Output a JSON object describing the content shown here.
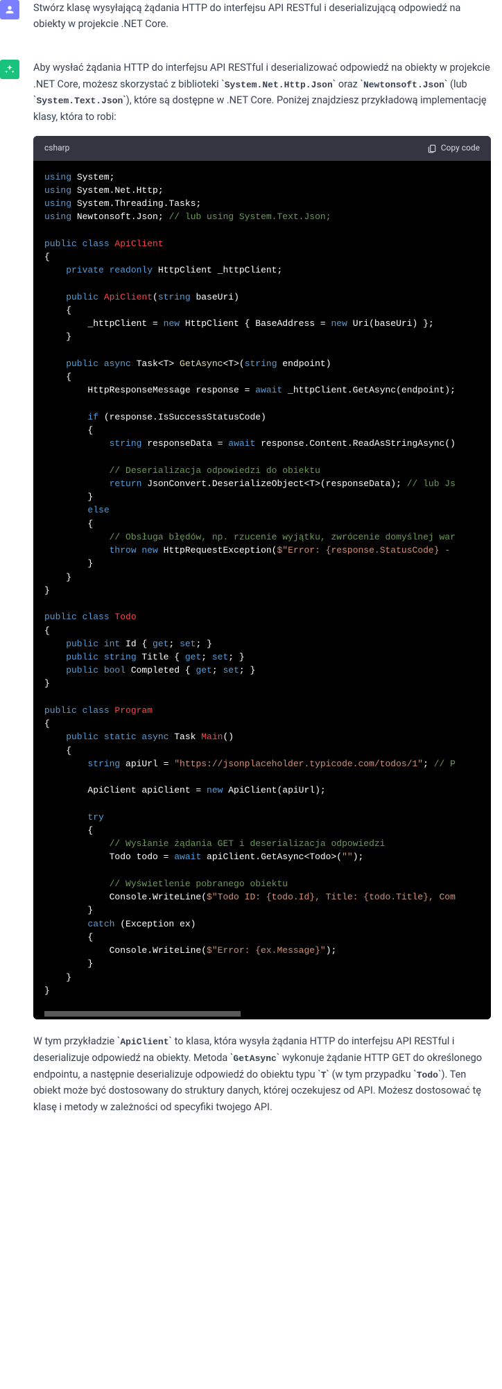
{
  "user": {
    "text": "Stwórz klasę wysyłającą żądania HTTP do interfejsu API RESTful i deserializującą odpowiedź na obiekty w projekcie .NET Core."
  },
  "assistant": {
    "intro_1": "Aby wysłać żądania HTTP do interfejsu API RESTful i deserializować odpowiedź na obiekty w projekcie .NET Core, możesz skorzystać z biblioteki ",
    "code_1": "System.Net.Http.Json",
    "intro_2": " oraz ",
    "code_2": "Newtonsoft.Json",
    "intro_3": " (lub ",
    "code_3": "System.Text.Json",
    "intro_4": "), które są dostępne w .NET Core. Poniżej znajdziesz przykładową implementację klasy, która to robi:",
    "outro_1": "W tym przykładzie ",
    "o_code_1": "ApiClient",
    "outro_2": " to klasa, która wysyła żądania HTTP do interfejsu API RESTful i deserializuje odpowiedź na obiekty. Metoda ",
    "o_code_2": "GetAsync",
    "outro_3": " wykonuje żądanie HTTP GET do określonego endpointu, a następnie deserializuje odpowiedź do obiektu typu ",
    "o_code_3": "T",
    "outro_4": " (w tym przypadku ",
    "o_code_4": "Todo",
    "outro_5": "). Ten obiekt może być dostosowany do struktury danych, której oczekujesz od API. Możesz dostosować tę klasę i metody w zależności od specyfiki twojego API."
  },
  "codeblock": {
    "lang": "csharp",
    "copy_label": "Copy code"
  },
  "code": {
    "l01a": "using",
    "l01b": " System;",
    "l02a": "using",
    "l02b": " System.Net.Http;",
    "l03a": "using",
    "l03b": " System.Threading.Tasks;",
    "l04a": "using",
    "l04b": " Newtonsoft.Json; ",
    "l04c": "// lub using System.Text.Json;",
    "l06a": "public",
    "l06b": " class",
    "l06c": " ApiClient",
    "l07": "{",
    "l08a": "    private",
    "l08b": " readonly",
    "l08c": " HttpClient _httpClient;",
    "l10a": "    public",
    "l10b": " ApiClient",
    "l10c": "(",
    "l10d": "string",
    "l10e": " baseUri)",
    "l11": "    {",
    "l12a": "        _httpClient = ",
    "l12b": "new",
    "l12c": " HttpClient { BaseAddress = ",
    "l12d": "new",
    "l12e": " Uri(baseUri) };",
    "l13": "    }",
    "l15a": "    public",
    "l15b": " async",
    "l15c": " Task<T> ",
    "l15d": "GetAsync",
    "l15e": "<T>(",
    "l15f": "string",
    "l15g": " endpoint)",
    "l16": "    {",
    "l17a": "        HttpResponseMessage response = ",
    "l17b": "await",
    "l17c": " _httpClient.GetAsync(endpoint);",
    "l19a": "        if",
    "l19b": " (response.IsSuccessStatusCode)",
    "l20": "        {",
    "l21a": "            string",
    "l21b": " responseData = ",
    "l21c": "await",
    "l21d": " response.Content.ReadAsStringAsync()",
    "l23": "            // Deserializacja odpowiedzi do obiektu",
    "l24a": "            return",
    "l24b": " JsonConvert.DeserializeObject<T>(responseData); ",
    "l24c": "// lub Js",
    "l25": "        }",
    "l26a": "        else",
    "l27": "        {",
    "l28": "            // Obsługa błędów, np. rzucenie wyjątku, zwrócenie domyślnej war",
    "l29a": "            throw",
    "l29b": " new",
    "l29c": " HttpRequestException(",
    "l29d": "$\"Error: {response.StatusCode} -",
    "l30": "        }",
    "l31": "    }",
    "l32": "}",
    "l34a": "public",
    "l34b": " class",
    "l34c": " Todo",
    "l35": "{",
    "l36a": "    public",
    "l36b": " int",
    "l36c": " Id { ",
    "l36d": "get",
    "l36e": "; ",
    "l36f": "set",
    "l36g": "; }",
    "l37a": "    public",
    "l37b": " string",
    "l37c": " Title { ",
    "l37d": "get",
    "l37e": "; ",
    "l37f": "set",
    "l37g": "; }",
    "l38a": "    public",
    "l38b": " bool",
    "l38c": " Completed { ",
    "l38d": "get",
    "l38e": "; ",
    "l38f": "set",
    "l38g": "; }",
    "l39": "}",
    "l41a": "public",
    "l41b": " class",
    "l41c": " Program",
    "l42": "{",
    "l43a": "    public",
    "l43b": " static",
    "l43c": " async",
    "l43d": " Task ",
    "l43e": "Main",
    "l43f": "()",
    "l44": "    {",
    "l45a": "        string",
    "l45b": " apiUrl = ",
    "l45c": "\"https://jsonplaceholder.typicode.com/todos/1\"",
    "l45d": "; ",
    "l45e": "// P",
    "l47a": "        ApiClient apiClient = ",
    "l47b": "new",
    "l47c": " ApiClient(apiUrl);",
    "l49a": "        try",
    "l50": "        {",
    "l51": "            // Wysłanie żądania GET i deserializacja odpowiedzi",
    "l52a": "            Todo todo = ",
    "l52b": "await",
    "l52c": " apiClient.GetAsync<Todo>(",
    "l52d": "\"\"",
    "l52e": ");",
    "l54": "            // Wyświetlenie pobranego obiektu",
    "l55a": "            Console.WriteLine(",
    "l55b": "$\"Todo ID: {todo.Id}, Title: {todo.Title}, Com",
    "l56": "        }",
    "l57a": "        catch",
    "l57b": " (Exception ex)",
    "l58": "        {",
    "l59a": "            Console.WriteLine(",
    "l59b": "$\"Error: {ex.Message}\"",
    "l59c": ");",
    "l60": "        }",
    "l61": "    }",
    "l62": "}"
  }
}
